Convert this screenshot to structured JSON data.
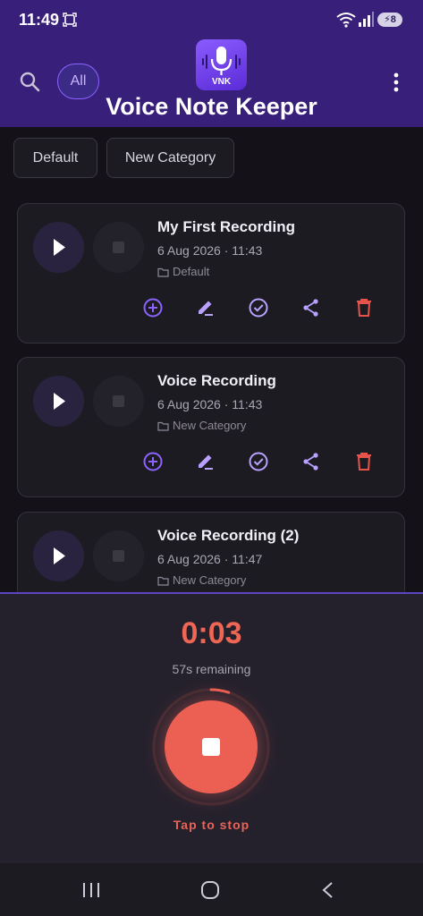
{
  "status_bar": {
    "time": "11:49",
    "battery": "8"
  },
  "header": {
    "filter_chip": "All",
    "logo_text": "VNK",
    "title": "Voice Note Keeper"
  },
  "categories": [
    "Default",
    "New Category"
  ],
  "recordings": [
    {
      "title": "My First Recording",
      "date": "6 Aug 2026 · 11:43",
      "category": "Default"
    },
    {
      "title": "Voice Recording",
      "date": "6 Aug 2026 · 11:43",
      "category": "New Category"
    },
    {
      "title": "Voice Recording (2)",
      "date": "6 Aug 2026 · 11:47",
      "category": "New Category"
    }
  ],
  "recorder": {
    "elapsed": "0:03",
    "remaining": "57s remaining",
    "hint": "Tap to stop",
    "progress": 0.05
  },
  "colors": {
    "accent": "#8c63ff",
    "header": "#371f7a",
    "record": "#ec5f53",
    "delete": "#e5534b",
    "background": "#141218"
  }
}
